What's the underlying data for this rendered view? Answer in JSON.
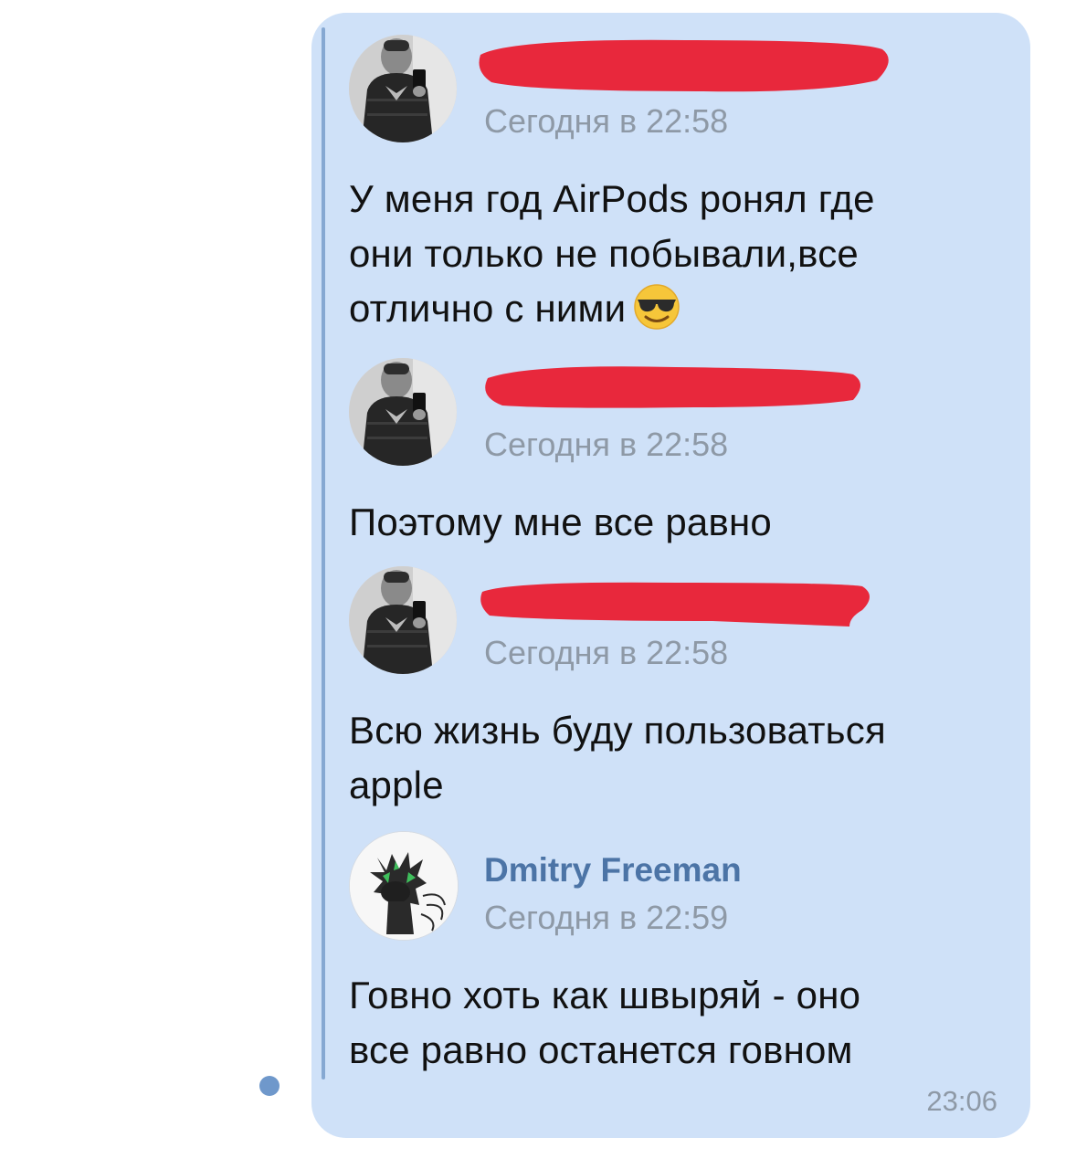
{
  "messages": [
    {
      "author": "",
      "author_redacted": true,
      "time": "Сегодня в 22:58",
      "text_lines": [
        "У меня год AirPods ронял где",
        "они только не побывали,все",
        "отлично с ними"
      ],
      "emoji": "smiling-face-with-sunglasses"
    },
    {
      "author": "",
      "author_redacted": true,
      "time": "Сегодня в 22:58",
      "text_lines": [
        "Поэтому мне все равно"
      ]
    },
    {
      "author": "",
      "author_redacted": true,
      "time": "Сегодня в 22:58",
      "text_lines": [
        "Всю жизнь буду пользоваться",
        "apple"
      ]
    },
    {
      "author": "Dmitry Freeman",
      "author_redacted": false,
      "time": "Сегодня в 22:59",
      "text_lines": [
        "Говно хоть как швыряй - оно",
        "все равно останется говном"
      ]
    }
  ],
  "bubble_time": "23:06",
  "colors": {
    "bubble_bg": "#cfe1f8",
    "forward_bar": "#86a8d2",
    "unread_dot": "#6f98cb",
    "author_name": "#4c74a6",
    "timestamp": "#8e99a6",
    "redaction": "#e8283c"
  }
}
